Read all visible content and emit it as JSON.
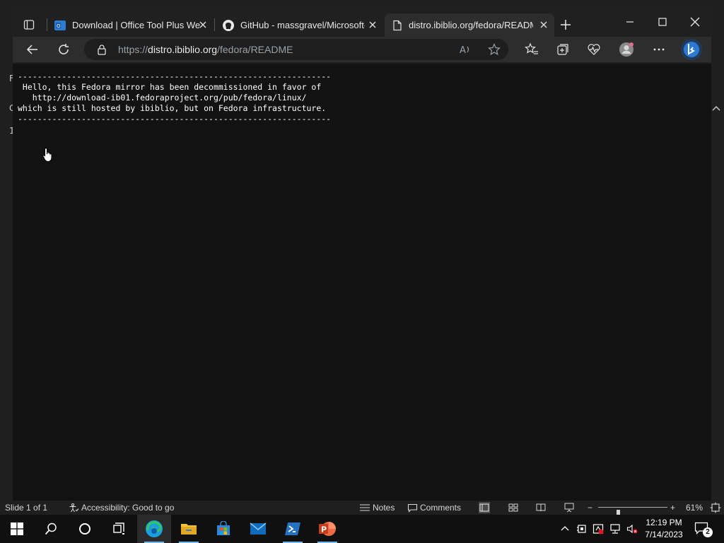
{
  "ppt_edge": {
    "char1": "F",
    "char2": "C",
    "char3": "1"
  },
  "browser": {
    "tabs": [
      {
        "title": "Download | Office Tool Plus Web",
        "icon": "office-tool-plus-icon"
      },
      {
        "title": "GitHub - massgravel/Microsoft-A",
        "icon": "github-icon"
      },
      {
        "title": "distro.ibiblio.org/fedora/READM",
        "icon": "document-icon"
      }
    ],
    "url_prefix": "https://",
    "url_host": "distro.ibiblio.org",
    "url_path": "/fedora/README"
  },
  "readme": {
    "text": "----------------------------------------------------------------\n Hello, this Fedora mirror has been decommissioned in favor of\n   http://download-ib01.fedoraproject.org/pub/fedora/linux/\nwhich is still hosted by ibiblio, but on Fedora infrastructure.\n----------------------------------------------------------------"
  },
  "statusbar": {
    "slide": "Slide 1 of 1",
    "accessibility": "Accessibility: Good to go",
    "notes": "Notes",
    "comments": "Comments",
    "zoom": "61%",
    "zoom_level": 0.61
  },
  "taskbar": {
    "time": "12:19 PM",
    "date": "7/14/2023",
    "notifications": "2",
    "apps": [
      "start",
      "search",
      "cortana",
      "task-view",
      "edge",
      "file-explorer",
      "microsoft-store",
      "mail",
      "powershell",
      "powerpoint"
    ]
  }
}
